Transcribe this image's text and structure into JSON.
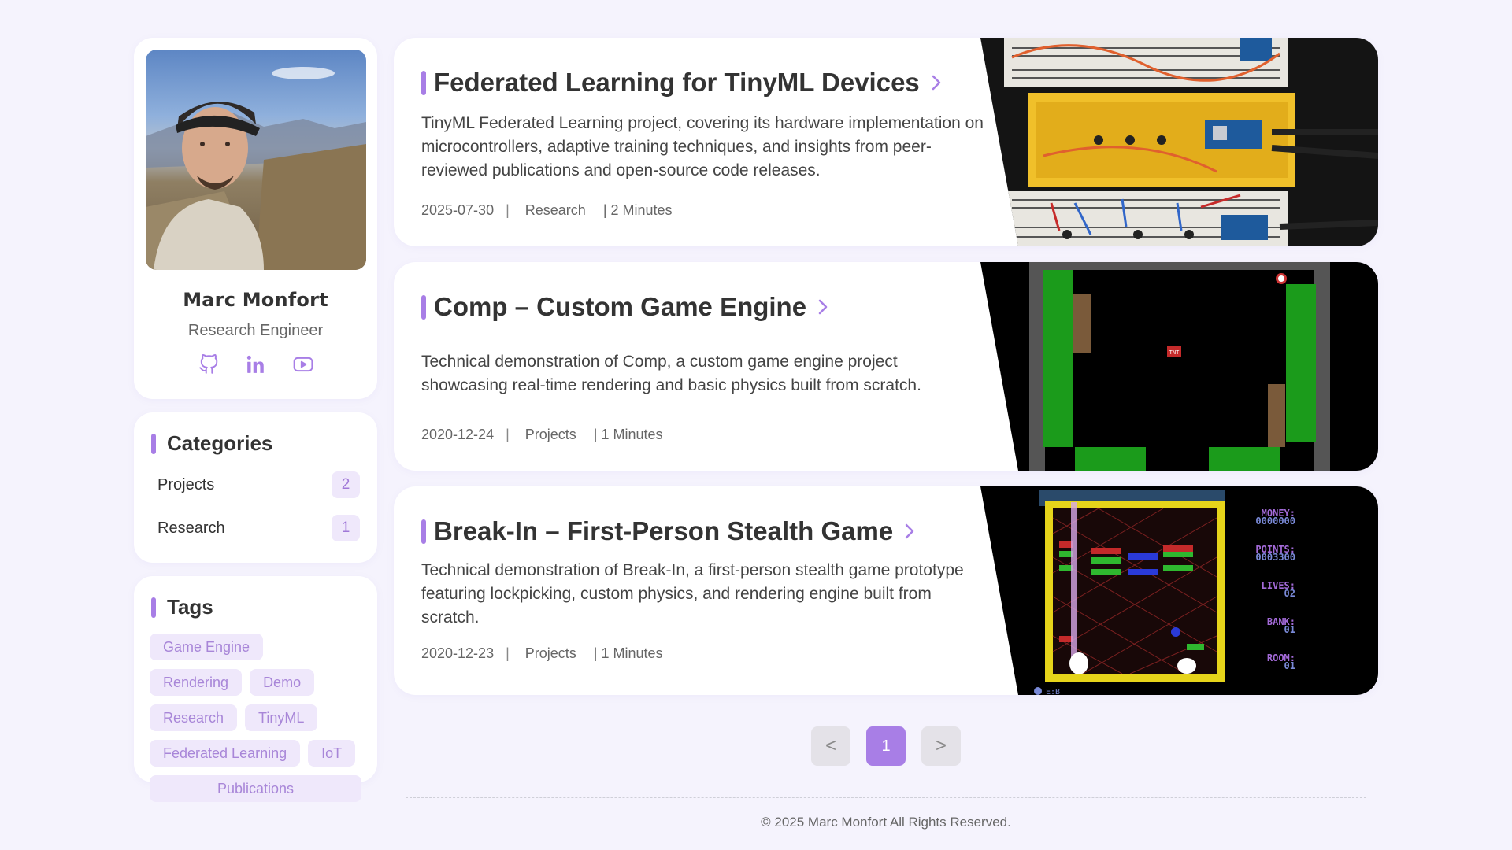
{
  "profile": {
    "name": "Marc Monfort",
    "role": "Research Engineer",
    "socials": [
      {
        "icon": "github-icon"
      },
      {
        "icon": "linkedin-icon"
      },
      {
        "icon": "youtube-icon"
      }
    ]
  },
  "categories": {
    "title": "Categories",
    "items": [
      {
        "label": "Projects",
        "count": "2"
      },
      {
        "label": "Research",
        "count": "1"
      }
    ]
  },
  "tags": {
    "title": "Tags",
    "items": [
      "Game Engine",
      "Rendering",
      "Demo",
      "Research",
      "TinyML",
      "Federated Learning",
      "IoT",
      "Publications"
    ]
  },
  "posts": [
    {
      "title": "Federated Learning for TinyML Devices",
      "description": "TinyML Federated Learning project, covering its hardware implementation on microcontrollers, adaptive training techniques, and insights from peer-reviewed publications and open-source code releases.",
      "date": "2025-07-30",
      "separator": "|",
      "category": "Research",
      "read_time": "| 2 Minutes"
    },
    {
      "title": "Comp – Custom Game Engine",
      "description": "Technical demonstration of Comp, a custom game engine project showcasing real-time rendering and basic physics built from scratch.",
      "date": "2020-12-24",
      "separator": "|",
      "category": "Projects",
      "read_time": "| 1 Minutes"
    },
    {
      "title": "Break-In – First-Person Stealth Game",
      "description": "Technical demonstration of Break-In, a first-person stealth game prototype featuring lockpicking, custom physics, and rendering engine built from scratch.",
      "date": "2020-12-23",
      "separator": "|",
      "category": "Projects",
      "read_time": "| 1 Minutes"
    }
  ],
  "game_hud": {
    "tnt_label": "TNT",
    "money_label": "MONEY:",
    "money_value": "0000000",
    "points_label": "POINTS:",
    "points_value": "0003300",
    "lives_label": "LIVES:",
    "lives_value": "02",
    "bank_label": "BANK:",
    "bank_value": "01",
    "room_label": "ROOM:",
    "room_value": "01",
    "corner_label": "E:B"
  },
  "pagination": {
    "prev": "<",
    "current": "1",
    "next": ">"
  },
  "footer": {
    "copyright": "© 2025 Marc Monfort All Rights Reserved."
  },
  "colors": {
    "accent": "#a87ee6",
    "background": "#f5f3fd",
    "tag_bg": "#efe8fb"
  }
}
